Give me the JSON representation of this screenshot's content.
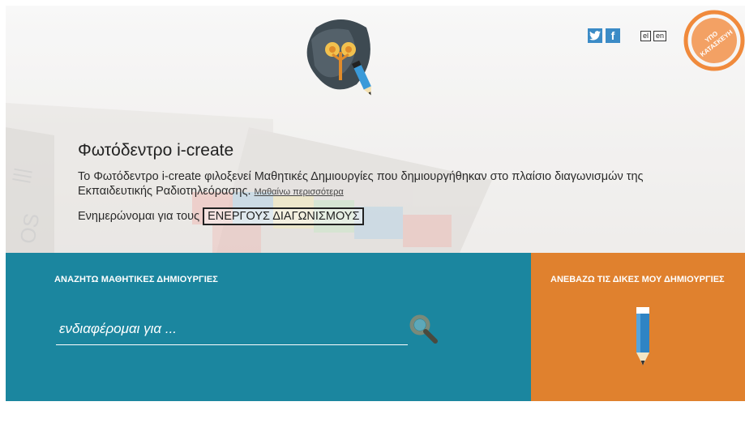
{
  "hero": {
    "title": "Φωτόδεντρο i-create",
    "description": "Το Φωτόδεντρο i-create φιλοξενεί Μαθητικές Δημιουργίες που δημιουργήθηκαν στο πλαίσιο διαγωνισμών της Εκπαιδευτικής Ραδιοτηλεόρασης.",
    "learn_more": "Μαθαίνω περισσότερα",
    "contests_prefix": "Ενημερώνομαι για τους",
    "contests_button": "ΕΝΕΡΓΟΥΣ ΔΙΑΓΩΝΙΣΜΟΥΣ"
  },
  "social": {
    "twitter_icon": "twitter-icon",
    "facebook_icon": "facebook-icon"
  },
  "languages": [
    "el",
    "en"
  ],
  "stamp": {
    "line1": "ΥΠΟ",
    "line2": "ΚΑΤΑΣΚΕΥΗ"
  },
  "search": {
    "heading": "ΑΝΑΖΗΤΩ ΜΑΘΗΤΙΚΕΣ ΔΗΜΙΟΥΡΓΙΕΣ",
    "placeholder": "ενδιαφέρομαι για ...",
    "value": ""
  },
  "upload": {
    "heading": "ΑΝΕΒΑΖΩ ΤΙΣ ΔΙΚΕΣ ΜΟΥ ΔΗΜΙΟΥΡΓΙΕΣ"
  },
  "colors": {
    "search_bg": "#1b869f",
    "upload_bg": "#e0812e",
    "social_blue": "#3b8bc6",
    "stamp_orange": "#f08a3c"
  }
}
